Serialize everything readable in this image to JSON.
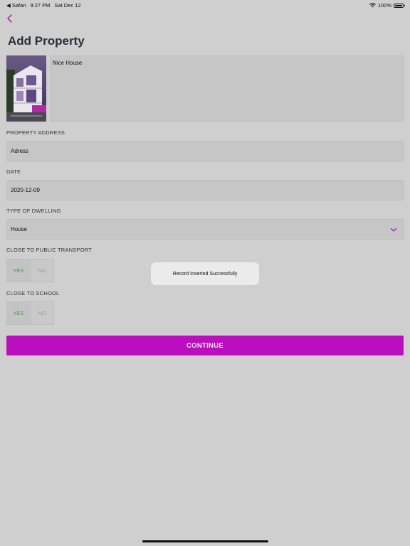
{
  "status_bar": {
    "back_app": "◀ Safari",
    "time": "9:27 PM",
    "date": "Sat Dec 12",
    "battery": "100%",
    "battery_level": 1.0
  },
  "title": "Add Property",
  "property_name": "Nice House",
  "address": {
    "label": "PROPERTY ADDRESS",
    "value": "Adress"
  },
  "date": {
    "label": "DATE",
    "value": "2020-12-09"
  },
  "dwelling": {
    "label": "TYPE OF DWELLING",
    "value": "House"
  },
  "transport": {
    "label": "CLOSE TO PUBLIC TRANSPORT",
    "yes": "YES",
    "no": "NO",
    "selected": "YES"
  },
  "school": {
    "label": "CLOSE TO SCHOOL",
    "yes": "YES",
    "no": "NO",
    "selected": "YES"
  },
  "toast": "Record Inserted Successfully",
  "continue_label": "CONTINUE",
  "colors": {
    "accent": "#bb0fbf",
    "yes_green": "#3aa23a",
    "background": "#cfcfcf"
  },
  "icons": {
    "back": "chevron-left-icon",
    "dropdown": "chevron-down-icon",
    "wifi": "wifi-icon",
    "battery": "battery-icon"
  }
}
